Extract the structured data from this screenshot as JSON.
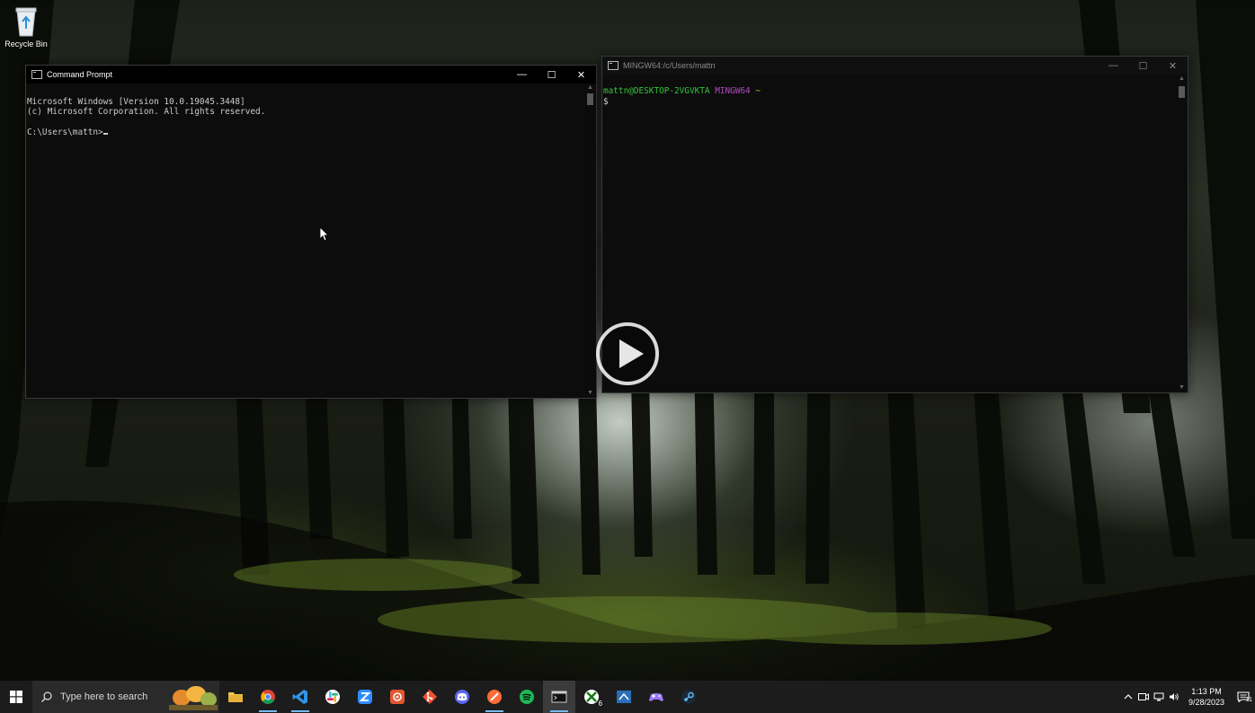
{
  "desktop": {
    "icons": [
      {
        "label": "Recycle Bin",
        "icon": "recycle-bin-icon"
      }
    ]
  },
  "windows": {
    "cmd": {
      "title": "Command Prompt",
      "lines": [
        "Microsoft Windows [Version 10.0.19045.3448]",
        "(c) Microsoft Corporation. All rights reserved.",
        "",
        "C:\\Users\\mattn>"
      ]
    },
    "mingw": {
      "title": "MINGW64:/c/Users/mattn",
      "prompt_user": "mattn@DESKTOP-2VGVKTA",
      "prompt_env": "MINGW64",
      "prompt_path": "~",
      "prompt_symbol": "$"
    },
    "controls": {
      "minimize": "—",
      "maximize": "☐",
      "close": "✕"
    }
  },
  "overlay": {
    "play_icon": "play-icon"
  },
  "taskbar": {
    "search_placeholder": "Type here to search",
    "apps": [
      {
        "name": "File Explorer",
        "icon": "folder-icon",
        "color": "#f2c94c"
      },
      {
        "name": "Chrome",
        "icon": "chrome-icon",
        "color": "#db4437"
      },
      {
        "name": "Visual Studio Code",
        "icon": "vscode-icon",
        "color": "#2f95e8"
      },
      {
        "name": "Slack",
        "icon": "slack-icon",
        "color": "#e01e5a"
      },
      {
        "name": "Zoom",
        "icon": "zoom-icon",
        "color": "#2d8cff"
      },
      {
        "name": "Capture",
        "icon": "capture-icon",
        "color": "#e4572e"
      },
      {
        "name": "Git",
        "icon": "git-icon",
        "color": "#f05032"
      },
      {
        "name": "Discord",
        "icon": "discord-icon",
        "color": "#5865f2"
      },
      {
        "name": "Postman",
        "icon": "postman-icon",
        "color": "#ff6c37"
      },
      {
        "name": "Spotify",
        "icon": "spotify-icon",
        "color": "#1db954"
      },
      {
        "name": "Terminal",
        "icon": "terminal-icon",
        "color": "#cccccc"
      },
      {
        "name": "Xbox",
        "icon": "xbox-icon",
        "color": "#107c10",
        "badge": "6"
      },
      {
        "name": "Remote",
        "icon": "remote-icon",
        "color": "#2a6eb8"
      },
      {
        "name": "Game Controller",
        "icon": "gamepad-icon",
        "color": "#9b7bf5"
      },
      {
        "name": "Steam",
        "icon": "steam-icon",
        "color": "#66c0f4"
      }
    ],
    "tray": {
      "chevron": "^",
      "time": "1:13 PM",
      "date": "9/28/2023",
      "notification_count": "11"
    }
  }
}
